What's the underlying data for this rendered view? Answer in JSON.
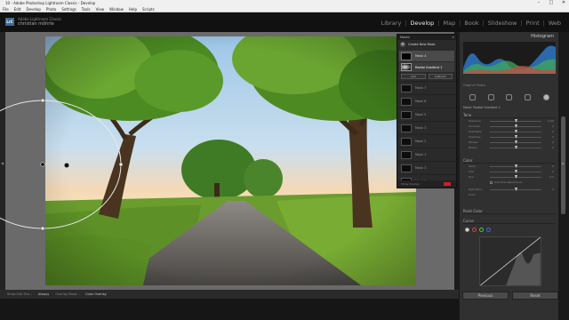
{
  "window": {
    "title": "10 - Adobe Photoshop Lightroom Classic - Develop",
    "controls": [
      "–",
      "□",
      "✕"
    ]
  },
  "menu": [
    "File",
    "Edit",
    "Develop",
    "Photo",
    "Settings",
    "Tools",
    "View",
    "Window",
    "Help",
    "Scripts"
  ],
  "identity": {
    "logo": "LrC",
    "line1": "Adobe Lightroom Classic",
    "line2": "christian möhrle"
  },
  "modules": [
    "Library",
    "Develop",
    "Map",
    "Book",
    "Slideshow",
    "Print",
    "Web"
  ],
  "active_module": "Develop",
  "mask_panel": {
    "title": "Masks",
    "create": "Create New Mask",
    "masks": [
      {
        "label": "Mask 4",
        "selected": true
      },
      {
        "label": "Radial Gradient 1",
        "selected": true,
        "sub": true
      }
    ],
    "buttons": [
      "Add",
      "Subtract"
    ],
    "list": [
      "Mask 7",
      "Mask 6",
      "Mask 5",
      "Mask 3",
      "Mask 2",
      "Mask 1",
      "Mask 3",
      "Mask 2"
    ],
    "footer": "Show Overlay",
    "overlay_color": "#cc1f2a"
  },
  "right_panel": {
    "histogram_title": "Histogram",
    "original_photo": "Original Photo",
    "mask_settings": "Mask: Radial Gradient 1",
    "tone_title": "Tone",
    "tone_rows": [
      {
        "label": "Exposure",
        "val": "0.00"
      },
      {
        "label": "Contrast",
        "val": "0"
      },
      {
        "label": "Highlights",
        "val": "0"
      },
      {
        "label": "Shadows",
        "val": "0"
      },
      {
        "label": "Whites",
        "val": "0"
      },
      {
        "label": "Blacks",
        "val": "0"
      }
    ],
    "color_title": "Color",
    "color_rows": [
      {
        "label": "Temp",
        "val": "0"
      },
      {
        "label": "Tint",
        "val": "0"
      },
      {
        "label": "Hue",
        "val": "0.0"
      },
      {
        "label": "Saturation",
        "val": "0"
      }
    ],
    "fine": "Use Fine Adjustment",
    "color_label": "Color",
    "point_color": "Point Color",
    "curve_title": "Curve",
    "buttons": [
      "Previous",
      "Reset"
    ]
  },
  "bottombar": {
    "show_edit_pins": "Show Edit Pins :",
    "always": "Always",
    "overlay_mode": "Overlay Mode :",
    "color_overlay": "Color Overlay"
  }
}
